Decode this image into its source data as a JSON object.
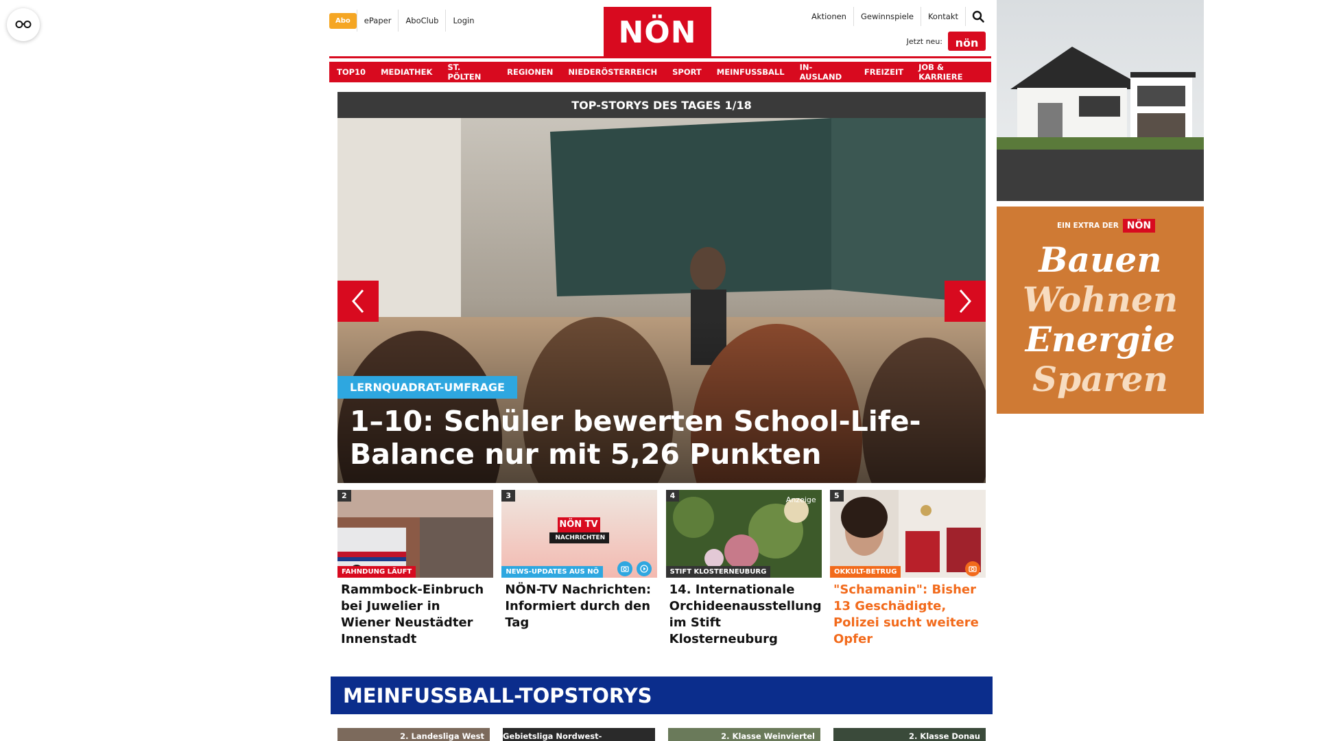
{
  "header": {
    "abo_label": "Abo",
    "links_left": [
      "ePaper",
      "AboClub",
      "Login"
    ],
    "logo_text": "NÖN",
    "links_right": [
      "Aktionen",
      "Gewinnspiele",
      "Kontakt"
    ],
    "jetzt_label": "Jetzt neu:",
    "jetzt_badge": "nön"
  },
  "nav": [
    "TOP10",
    "MEDIATHEK",
    "ST. PÖLTEN",
    "REGIONEN",
    "NIEDERÖSTERREICH",
    "SPORT",
    "MEINFUSSBALL",
    "IN-AUSLAND",
    "FREIZEIT",
    "JOB & KARRIERE"
  ],
  "hero": {
    "heading": "TOP-STORYS DES TAGES 1/18",
    "tag": "LERNQUADRAT-UMFRAGE",
    "title": "1–10: Schüler bewerten School-Life-Balance nur mit 5,26 Punkten"
  },
  "stories": [
    {
      "num": "2",
      "tag": "FAHNDUNG LÄUFT",
      "tag_color": "#d80a1f",
      "title": "Rammbock-Einbruch bei Juwelier in Wiener Neustädter Innenstadt",
      "title_color": "#111111"
    },
    {
      "num": "3",
      "tag": "NEWS-UPDATES AUS NÖ",
      "tag_color": "#2ea7e0",
      "title": "NÖN-TV Nachrichten: Informiert durch den Tag",
      "title_color": "#111111",
      "tv_logo": "NÖN TV",
      "tv_sub": "NACHRICHTEN"
    },
    {
      "num": "4",
      "tag": "STIFT KLOSTERNEUBURG",
      "tag_color": "#333333",
      "title": "14. Internationale Orchideenausstellung im Stift Klosterneuburg",
      "title_color": "#111111",
      "ad_label": "Anzeige"
    },
    {
      "num": "5",
      "tag": "OKKULT-BETRUG",
      "tag_color": "#f26a1b",
      "title": "\"Schamanin\": Bisher 13 Geschädigte, Polizei sucht weitere Opfer",
      "title_color": "#f26a1b"
    }
  ],
  "meinfussball": {
    "heading": "MEINFUSSBALL-TOPSTORYS",
    "thumbs": [
      "2. Landesliga West",
      "Gebietsliga Nordwest-Waldviertel",
      "2. Klasse Weinviertel",
      "2. Klasse Donau"
    ]
  },
  "ads": {
    "extra_label": "EIN EXTRA DER",
    "extra_brand": "NÖN",
    "lines": [
      "Bauen",
      "Wohnen",
      "Energie",
      "Sparen"
    ]
  },
  "colors": {
    "brand_red": "#d80a1f",
    "mf_blue": "#0b2d8c",
    "accent_orange": "#f5a623",
    "tag_blue": "#2ea7e0"
  }
}
